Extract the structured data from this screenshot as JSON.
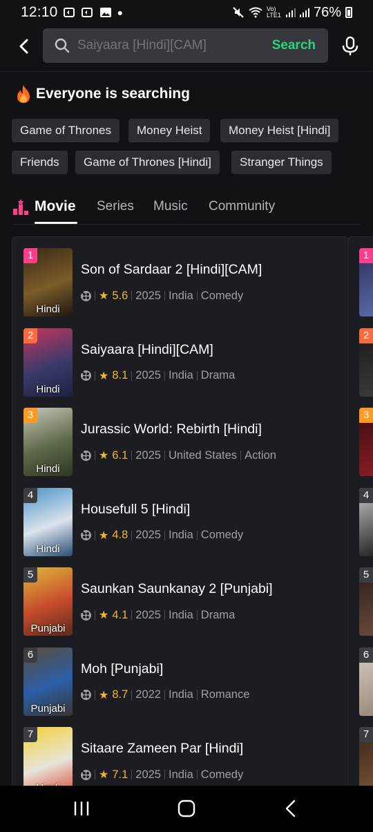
{
  "status_bar": {
    "time": "12:10",
    "carrier_badge": "Vo) LTE1",
    "battery": "76%"
  },
  "search": {
    "placeholder": "Saiyaara [Hindi][CAM]",
    "button_label": "Search"
  },
  "trending": {
    "title": "Everyone is searching",
    "chips": [
      "Game of Thrones",
      "Money Heist",
      "Money Heist [Hindi]",
      "Friends",
      "Game of Thrones [Hindi]",
      "Stranger Things"
    ]
  },
  "tabs": [
    {
      "label": "Movie",
      "active": true
    },
    {
      "label": "Series",
      "active": false
    },
    {
      "label": "Music",
      "active": false
    },
    {
      "label": "Community",
      "active": false
    }
  ],
  "items": [
    {
      "rank": "1",
      "title": "Son of Sardaar 2 [Hindi][CAM]",
      "rating": "5.6",
      "year": "2025",
      "country": "India",
      "genre": "Comedy",
      "lang": "Hindi",
      "rank_color": "#ff3d8b",
      "poster_colors": [
        "#3a2a14",
        "#7a5c2a",
        "#1f1710"
      ]
    },
    {
      "rank": "2",
      "title": "Saiyaara [Hindi][CAM]",
      "rating": "8.1",
      "year": "2025",
      "country": "India",
      "genre": "Drama",
      "lang": "Hindi",
      "rank_color": "#ff6a3d",
      "poster_colors": [
        "#c7355a",
        "#3b3a6b",
        "#1d2240"
      ]
    },
    {
      "rank": "3",
      "title": "Jurassic World: Rebirth [Hindi]",
      "rating": "6.1",
      "year": "2025",
      "country": "United States",
      "genre": "Action",
      "lang": "Hindi",
      "rank_color": "#ff9a1f",
      "poster_colors": [
        "#c9c6b8",
        "#5d6a48",
        "#2e3622"
      ]
    },
    {
      "rank": "4",
      "title": "Housefull 5 [Hindi]",
      "rating": "4.8",
      "year": "2025",
      "country": "India",
      "genre": "Comedy",
      "lang": "Hindi",
      "rank_color": "#3b3d42",
      "poster_colors": [
        "#4d93c7",
        "#d9e3ec",
        "#2b4e72"
      ]
    },
    {
      "rank": "5",
      "title": "Saunkan Saunkanay 2 [Punjabi]",
      "rating": "4.1",
      "year": "2025",
      "country": "India",
      "genre": "Drama",
      "lang": "Punjabi",
      "rank_color": "#3b3d42",
      "poster_colors": [
        "#e0b83a",
        "#c64b2c",
        "#5a2a1a"
      ]
    },
    {
      "rank": "6",
      "title": "Moh [Punjabi]",
      "rating": "8.7",
      "year": "2022",
      "country": "India",
      "genre": "Romance",
      "lang": "Punjabi",
      "rank_color": "#3b3d42",
      "poster_colors": [
        "#5d4b3a",
        "#2a5fa8",
        "#3a3430"
      ]
    },
    {
      "rank": "7",
      "title": "Sitaare Zameen Par [Hindi]",
      "rating": "7.1",
      "year": "2025",
      "country": "India",
      "genre": "Comedy",
      "lang": "Hindi",
      "rank_color": "#3b3d42",
      "poster_colors": [
        "#f2d23a",
        "#e8e4d8",
        "#d64a3a"
      ]
    }
  ],
  "peek_items": [
    {
      "rank": "1",
      "rank_color": "#ff3d8b",
      "poster_colors": [
        "#2a2f5a",
        "#5a6aa8"
      ]
    },
    {
      "rank": "2",
      "rank_color": "#ff6a3d",
      "poster_colors": [
        "#1a1a1a",
        "#3a3a3a"
      ]
    },
    {
      "rank": "3",
      "rank_color": "#ff9a1f",
      "poster_colors": [
        "#3a0e12",
        "#8a1c24"
      ]
    },
    {
      "rank": "4",
      "rank_color": "#3b3d42",
      "poster_colors": [
        "#c8c8c8",
        "#222222"
      ]
    },
    {
      "rank": "5",
      "rank_color": "#3b3d42",
      "poster_colors": [
        "#2a1e1a",
        "#6a4a3a"
      ]
    },
    {
      "rank": "6",
      "rank_color": "#3b3d42",
      "poster_colors": [
        "#d8cfc4",
        "#9a8878"
      ]
    },
    {
      "rank": "7",
      "rank_color": "#3b3d42",
      "poster_colors": [
        "#3a2418",
        "#7a5438"
      ]
    }
  ],
  "colors": {
    "accent_green": "#2fd27a",
    "rating_gold": "#f2b62b",
    "background": "#111216",
    "card": "#1c1d22"
  },
  "icons": {
    "back": "chevron-left-icon",
    "search": "search-icon",
    "mic": "microphone-icon",
    "fire": "fire-icon",
    "movie_tab": "ranking-icon",
    "reel": "film-reel-icon",
    "star": "star-icon"
  }
}
